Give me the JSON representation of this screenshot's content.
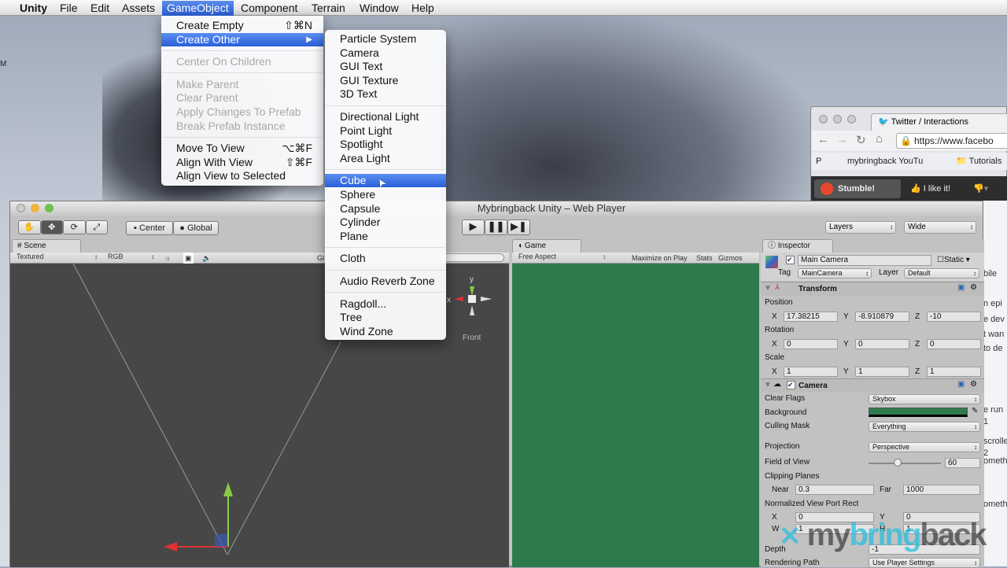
{
  "menubar": {
    "app": "Unity",
    "items": [
      "File",
      "Edit",
      "Assets",
      "GameObject",
      "Component",
      "Terrain",
      "Window",
      "Help"
    ]
  },
  "gameobject_menu": [
    {
      "label": "Create Empty",
      "shortcut": "⇧⌘N"
    },
    {
      "label": "Create Other",
      "submenu": true,
      "highlighted": true
    },
    {
      "sep": true
    },
    {
      "label": "Center On Children",
      "disabled": true
    },
    {
      "sep": true
    },
    {
      "label": "Make Parent",
      "disabled": true
    },
    {
      "label": "Clear Parent",
      "disabled": true
    },
    {
      "label": "Apply Changes To Prefab",
      "disabled": true
    },
    {
      "label": "Break Prefab Instance",
      "disabled": true
    },
    {
      "sep": true
    },
    {
      "label": "Move To View",
      "shortcut": "⌥⌘F"
    },
    {
      "label": "Align With View",
      "shortcut": "⇧⌘F"
    },
    {
      "label": "Align View to Selected"
    }
  ],
  "create_other_menu": [
    {
      "label": "Particle System"
    },
    {
      "label": "Camera"
    },
    {
      "label": "GUI Text"
    },
    {
      "label": "GUI Texture"
    },
    {
      "label": "3D Text"
    },
    {
      "sep": true
    },
    {
      "label": "Directional Light"
    },
    {
      "label": "Point Light"
    },
    {
      "label": "Spotlight"
    },
    {
      "label": "Area Light"
    },
    {
      "sep": true
    },
    {
      "label": "Cube",
      "highlighted": true
    },
    {
      "label": "Sphere"
    },
    {
      "label": "Capsule"
    },
    {
      "label": "Cylinder"
    },
    {
      "label": "Plane"
    },
    {
      "sep": true
    },
    {
      "label": "Cloth"
    },
    {
      "sep": true
    },
    {
      "label": "Audio Reverb Zone"
    },
    {
      "sep": true
    },
    {
      "label": "Ragdoll..."
    },
    {
      "label": "Tree"
    },
    {
      "label": "Wind Zone"
    }
  ],
  "window": {
    "title": "Mybringback Unity – Web Player"
  },
  "toolbar": {
    "center": "Center",
    "global": "Global",
    "layers": "Layers",
    "layout": "Wide"
  },
  "scene": {
    "tab": "Scene",
    "render_mode": "Textured",
    "channel": "RGB",
    "gizmos_cut": "Gi",
    "gizmo_label": "Front",
    "axis_y": "y",
    "axis_x": "x"
  },
  "game": {
    "tab": "Game",
    "aspect": "Free Aspect",
    "maximize": "Maximize on Play",
    "stats": "Stats",
    "gizmos": "Gizmos",
    "bg_color": "#2f7a4c"
  },
  "inspector": {
    "tab": "Inspector",
    "object_name": "Main Camera",
    "static": "Static",
    "tag_label": "Tag",
    "tag": "MainCamera",
    "layer_label": "Layer",
    "layer": "Default",
    "transform": {
      "title": "Transform",
      "position": "Position",
      "rotation": "Rotation",
      "scale": "Scale",
      "pos": [
        "17.38215",
        "-8.910879",
        "-10"
      ],
      "rot": [
        "0",
        "0",
        "0"
      ],
      "scl": [
        "1",
        "1",
        "1"
      ]
    },
    "axes": [
      "X",
      "Y",
      "Z"
    ],
    "camera": {
      "title": "Camera",
      "clear_flags_label": "Clear Flags",
      "clear_flags": "Skybox",
      "background_label": "Background",
      "background_color": "#2f7a4c",
      "culling_label": "Culling Mask",
      "culling": "Everything",
      "projection_label": "Projection",
      "projection": "Perspective",
      "fov_label": "Field of View",
      "fov": "60",
      "fov_fraction": 0.4,
      "clipping_label": "Clipping Planes",
      "near_label": "Near",
      "near": "0.3",
      "far_label": "Far",
      "far": "1000",
      "viewport_label": "Normalized View Port Rect",
      "vx_label": "X",
      "vx": "0",
      "vy_label": "Y",
      "vy": "0",
      "vw_label": "W",
      "vw": "1",
      "vh_label": "H",
      "vh": "1",
      "depth_label": "Depth",
      "depth": "-1",
      "render_path_label": "Rendering Path",
      "render_path": "Use Player Settings"
    }
  },
  "browser": {
    "tab": "Twitter / Interactions",
    "url": "https://www.facebo",
    "bookmarks": [
      "P",
      "mybringback YouTu",
      "Tutorials"
    ],
    "stumble": "Stumble!",
    "like": "I like it!"
  },
  "webpage_snippets": [
    "bile",
    "n epi",
    "e dev",
    "t wan",
    "to de",
    "e run",
    "1",
    "scrolle",
    "2",
    "ometh",
    "ometh"
  ],
  "watermark": {
    "a": "my",
    "b": "bring",
    "c": "back"
  },
  "desktop_edge": "M"
}
